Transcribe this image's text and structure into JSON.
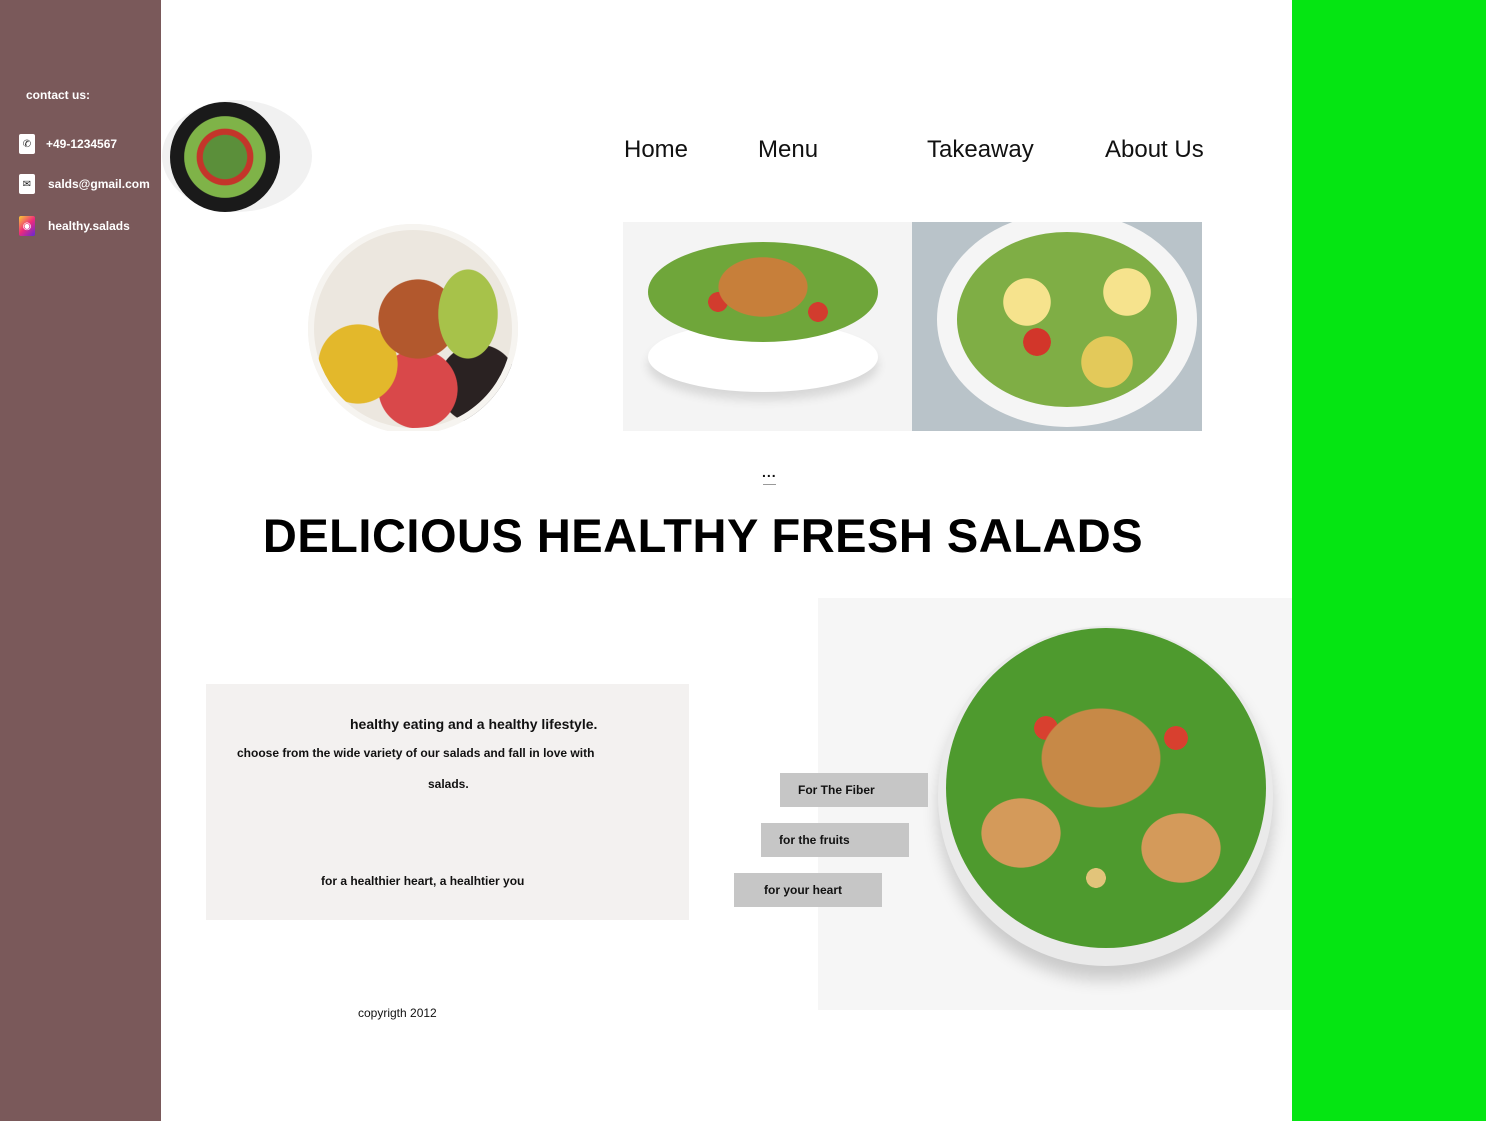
{
  "contact": {
    "title": "contact us:",
    "phone": "+49-1234567",
    "email": "salds@gmail.com",
    "instagram": "healthy.salads"
  },
  "nav": {
    "home": "Home",
    "menu": "Menu",
    "takeaway": "Takeaway",
    "about": "About Us"
  },
  "carousel": {
    "indicator": "..."
  },
  "headline": "DELICIOUS HEALTHY FRESH SALADS",
  "info": {
    "line1": "healthy eating and a healthy lifestyle.",
    "line2": "choose from the wide variety of our salads and fall in love with",
    "line3": "salads.",
    "line4": "for a healthier heart, a healhtier you"
  },
  "tags": {
    "fiber": "For The Fiber",
    "fruits": "for the fruits",
    "heart": "for your heart"
  },
  "footer": {
    "copyright": "copyrigth 2012"
  },
  "icons": {
    "phone": "phone-icon",
    "email": "mail-icon",
    "instagram": "instagram-icon"
  },
  "colors": {
    "sidebar": "#7a595a",
    "right_bar": "#05e512",
    "info_box": "#f3f1f0",
    "tag": "#c6c6c6"
  }
}
